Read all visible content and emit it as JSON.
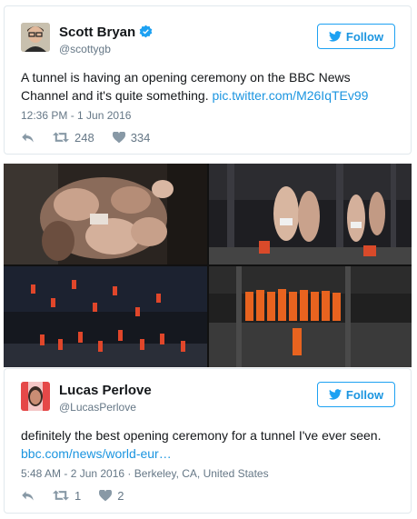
{
  "tweet1": {
    "name": "Scott Bryan",
    "handle": "@scottygb",
    "follow_label": "Follow",
    "text": "A tunnel is having an opening ceremony on the BBC News Channel and it's quite something.",
    "link": "pic.twitter.com/M26IqTEv99",
    "timestamp": "12:36 PM - 1 Jun 2016",
    "retweets": "248",
    "likes": "334"
  },
  "tweet2": {
    "name": "Lucas Perlove",
    "handle": "@LucasPerlove",
    "follow_label": "Follow",
    "text": "definitely the best opening ceremony for a tunnel I've ever seen.",
    "link": "bbc.com/news/world-eur…",
    "timestamp": "5:48 AM - 2 Jun 2016",
    "location": "Berkeley, CA, United States",
    "retweets": "1",
    "likes": "2"
  },
  "colors": {
    "link": "#1b95e0",
    "muted": "#657786",
    "border": "#e1e8ed",
    "verified": "#1da1f2"
  },
  "icons": [
    "verified-badge-icon",
    "twitter-bird-icon",
    "reply-icon",
    "retweet-icon",
    "like-heart-icon"
  ]
}
